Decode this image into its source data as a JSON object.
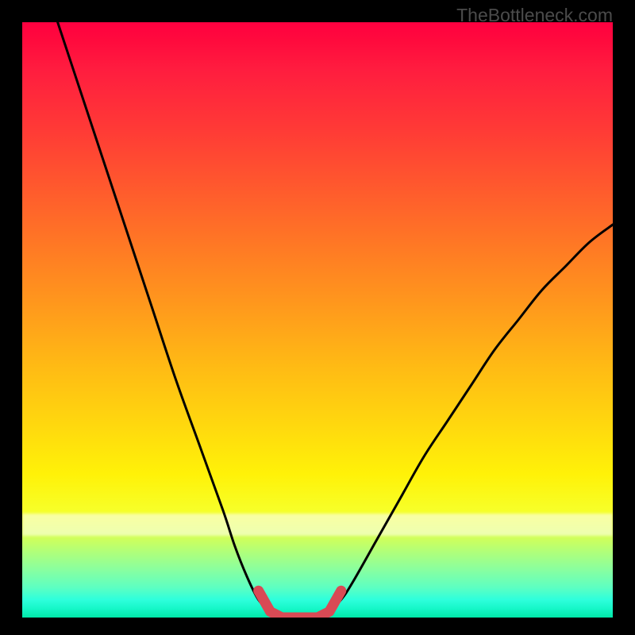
{
  "brand": "TheBottleneck.com",
  "colors": {
    "frame": "#000000",
    "brand_text": "#4b4b4b",
    "curve": "#000000",
    "highlight": "#d94a55"
  },
  "chart_data": {
    "type": "line",
    "title": "",
    "xlabel": "",
    "ylabel": "",
    "xlim": [
      0,
      100
    ],
    "ylim": [
      0,
      100
    ],
    "series": [
      {
        "name": "left-curve",
        "x": [
          6,
          10,
          14,
          18,
          22,
          26,
          30,
          34,
          36,
          38,
          40,
          42
        ],
        "y": [
          100,
          88,
          76,
          64,
          52,
          40,
          29,
          18,
          12,
          7,
          3,
          1
        ]
      },
      {
        "name": "right-curve",
        "x": [
          52,
          54,
          56,
          60,
          64,
          68,
          72,
          76,
          80,
          84,
          88,
          92,
          96,
          100
        ],
        "y": [
          1,
          3,
          6,
          13,
          20,
          27,
          33,
          39,
          45,
          50,
          55,
          59,
          63,
          66
        ]
      },
      {
        "name": "highlight-bracket",
        "x": [
          40,
          42,
          44,
          50,
          52,
          54
        ],
        "y": [
          4.5,
          1,
          0,
          0,
          1,
          4.5
        ]
      }
    ]
  }
}
